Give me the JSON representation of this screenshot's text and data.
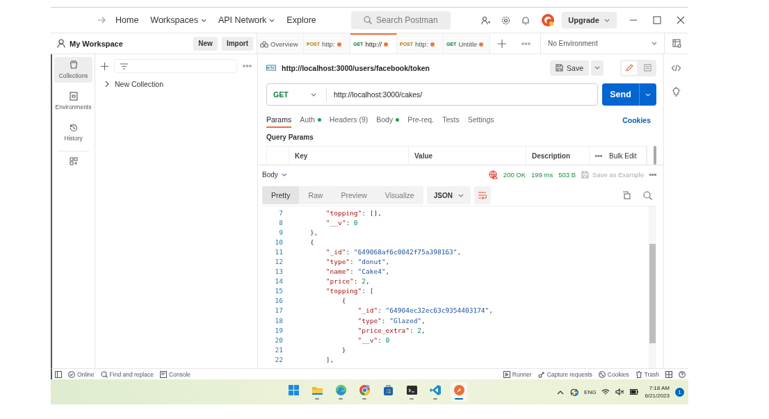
{
  "header": {
    "nav": [
      {
        "label": "Home",
        "dropdown": false
      },
      {
        "label": "Workspaces",
        "dropdown": true
      },
      {
        "label": "API Network",
        "dropdown": true
      },
      {
        "label": "Explore",
        "dropdown": false
      }
    ],
    "search": {
      "placeholder": "Search Postman"
    },
    "upgrade": "Upgrade"
  },
  "workspace": {
    "name": "My Workspace",
    "buttons": [
      "New",
      "Import"
    ]
  },
  "tabs": [
    {
      "kind": "overview",
      "label": "Overview",
      "selected": false,
      "unsaved": false
    },
    {
      "kind": "request",
      "method": "POST",
      "label": "http:",
      "selected": false,
      "unsaved": true
    },
    {
      "kind": "request",
      "method": "GET",
      "label": "http://",
      "selected": true,
      "unsaved": true
    },
    {
      "kind": "request",
      "method": "POST",
      "label": "http:",
      "selected": false,
      "unsaved": true
    },
    {
      "kind": "request",
      "method": "GET",
      "label": "Untitle",
      "selected": false,
      "unsaved": true
    }
  ],
  "environment": "No Environment",
  "sidebar": [
    {
      "label": "Collections",
      "selected": true
    },
    {
      "label": "Environments",
      "selected": false
    },
    {
      "label": "History",
      "selected": false
    }
  ],
  "collections": [
    {
      "label": "New Collection",
      "expanded": false
    }
  ],
  "request": {
    "title": "http://localhost:3000/users/facebook/token",
    "save": "Save",
    "method": "GET",
    "url": "http://localhost:3000/cakes/",
    "send": "Send",
    "tabs": [
      {
        "label": "Params",
        "selected": true,
        "dot": false
      },
      {
        "label": "Auth",
        "selected": false,
        "dot": true
      },
      {
        "label": "Headers (9)",
        "selected": false,
        "dot": false
      },
      {
        "label": "Body",
        "selected": false,
        "dot": true
      },
      {
        "label": "Pre-req.",
        "selected": false,
        "dot": false
      },
      {
        "label": "Tests",
        "selected": false,
        "dot": false
      },
      {
        "label": "Settings",
        "selected": false,
        "dot": false
      }
    ],
    "cookies": "Cookies",
    "query_title": "Query Params",
    "columns": [
      "Key",
      "Value",
      "Description"
    ],
    "bulk_edit": "Bulk Edit"
  },
  "response": {
    "label": "Body",
    "status": "200 OK",
    "time": "199 ms",
    "size": "503 B",
    "save_example": "Save as Example",
    "views": [
      {
        "label": "Pretty",
        "selected": true
      },
      {
        "label": "Raw",
        "selected": false
      },
      {
        "label": "Preview",
        "selected": false
      },
      {
        "label": "Visualize",
        "selected": false
      }
    ],
    "format": "JSON",
    "lines": [
      {
        "number": "7",
        "code": "        \"topping\": [],"
      },
      {
        "number": "8",
        "code": "        \"__v\": 0"
      },
      {
        "number": "9",
        "code": "    },"
      },
      {
        "number": "10",
        "code": "    {"
      },
      {
        "number": "11",
        "code": "        \"_id\": \"649068af6c0042f75a398163\","
      },
      {
        "number": "12",
        "code": "        \"type\": \"donut\","
      },
      {
        "number": "13",
        "code": "        \"name\": \"Cake4\","
      },
      {
        "number": "14",
        "code": "        \"price\": 2,"
      },
      {
        "number": "15",
        "code": "        \"topping\": ["
      },
      {
        "number": "16",
        "code": "            {"
      },
      {
        "number": "17",
        "code": "                \"_id\": \"64904ec32ec63c9354403174\","
      },
      {
        "number": "18",
        "code": "                \"type\": \"Glazed\","
      },
      {
        "number": "19",
        "code": "                \"price_extra\": 2,"
      },
      {
        "number": "20",
        "code": "                \"__v\": 0"
      },
      {
        "number": "21",
        "code": "            }"
      },
      {
        "number": "22",
        "code": "        ],"
      }
    ]
  },
  "status_bar": {
    "left": [
      "Online",
      "Find and replace",
      "Console"
    ],
    "right": [
      "Runner",
      "Capture requests",
      "Cookies",
      "Trash"
    ]
  },
  "taskbar": {
    "apps": [
      {
        "running": false,
        "active": false
      },
      {
        "running": true,
        "active": false
      },
      {
        "running": true,
        "active": false
      },
      {
        "running": true,
        "active": false
      },
      {
        "running": false,
        "active": false
      },
      {
        "running": true,
        "active": false
      },
      {
        "running": true,
        "active": false
      },
      {
        "running": true,
        "active": true
      }
    ],
    "language": "ENG",
    "time": "7:18 AM",
    "date": "6/21/2023",
    "notifications": "1"
  }
}
